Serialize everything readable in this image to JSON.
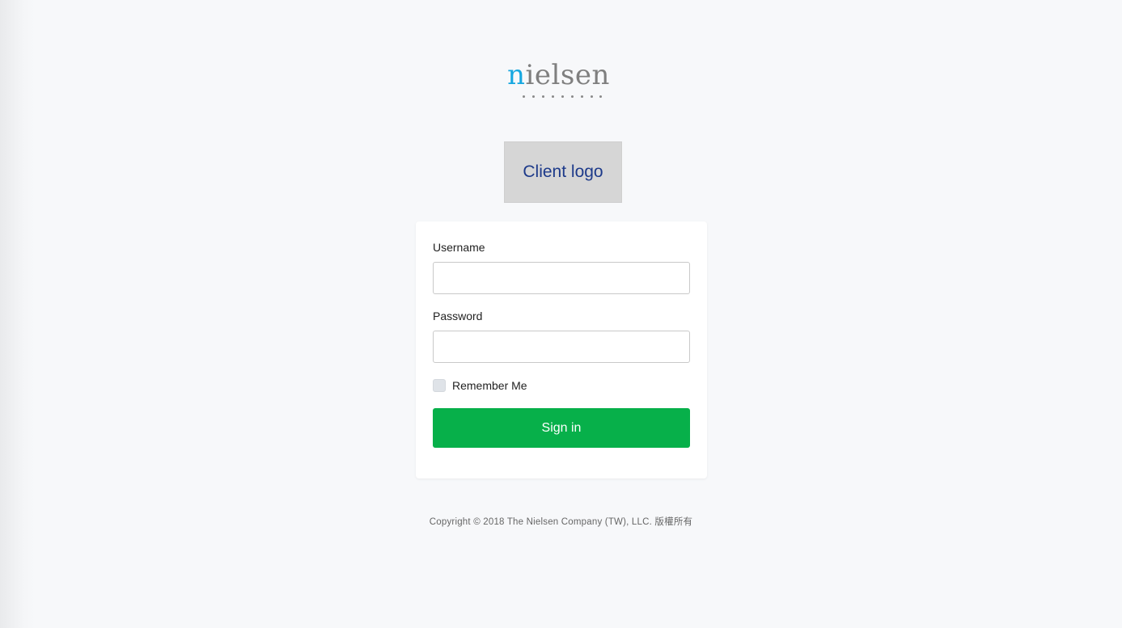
{
  "brand": {
    "name_first": "n",
    "name_rest": "ielsen",
    "accent_color": "#16a7e0"
  },
  "client_logo": {
    "label": "Client logo"
  },
  "form": {
    "username_label": "Username",
    "username_value": "",
    "password_label": "Password",
    "password_value": "",
    "remember_label": "Remember Me",
    "remember_checked": false,
    "submit_label": "Sign in",
    "submit_color": "#07b04a"
  },
  "footer": {
    "copyright": "Copyright © 2018 The Nielsen Company (TW), LLC. 版權所有"
  }
}
